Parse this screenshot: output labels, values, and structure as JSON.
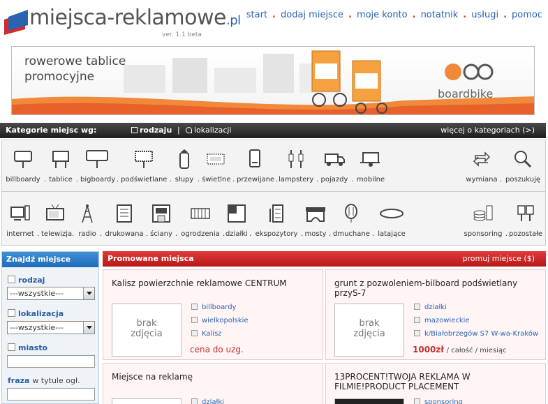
{
  "header": {
    "logo_text": "miejsca-reklamowe",
    "logo_tld": ".pl",
    "version": "ver. 1.1 beta",
    "nav": [
      "start",
      "dodaj miejsce",
      "moje konto",
      "notatnik",
      "usługi",
      "pomoc"
    ]
  },
  "banner": {
    "line1": "rowerowe tablice",
    "line2": "promocyjne",
    "brand": "boardbike"
  },
  "categories_bar": {
    "title": "Kategorie miejsc wg:",
    "mode_type": "rodzaju",
    "separator": "|",
    "mode_location": "lokalizacji",
    "more": "więcej o kategoriach (>)"
  },
  "categories_row1": [
    "billboardy",
    "tablice",
    "bigboardy",
    "podświetlane",
    "słupy",
    "świetlne",
    "przewijane",
    "lampstery",
    "pojazdy",
    "mobilne"
  ],
  "categories_row1_right": [
    "wymiana",
    "poszukuję"
  ],
  "categories_row2": [
    "internet",
    "telewizja",
    "radio",
    "drukowana",
    "ściany",
    "ogrodzenia",
    "działki",
    "ekspozytory",
    "mosty",
    "dmuchane",
    "latające"
  ],
  "categories_row2_right": [
    "sponsoring",
    "pozostałe"
  ],
  "sidebar": {
    "title": "Znajdź miejsce",
    "type_label": "rodzaj",
    "type_value": "---wszystkie---",
    "location_label": "lokalizacja",
    "location_value": "---wszystkie---",
    "city_label": "miasto",
    "phrase_label": "fraza",
    "phrase_sub": "w tytule ogł."
  },
  "main": {
    "title": "Promowane miejsca",
    "promote": "promuj miejsce ($)",
    "no_photo_1": "brak",
    "no_photo_2": "zdjęcia",
    "cards": [
      {
        "title": "Kalisz powierzchnie reklamowe CENTRUM",
        "cat": "billboardy",
        "region": "wielkopolskie",
        "place": "Kalisz",
        "price": "cena do uzg.",
        "price_extra": ""
      },
      {
        "title": "grunt z pozwoleniem-bilboard podświetlany przyS-7",
        "cat": "działki",
        "region": "mazowieckie",
        "place": "k/Białobrzegów S7 W-wa-Kraków",
        "price": "1000zł",
        "price_extra": "/ całość / miesiąc"
      },
      {
        "title": "Miejsce na reklamę",
        "cat": "działki"
      },
      {
        "title": "13PROCENT!TWOJA REKLAMA W FILMIE!PRODUCT PLACEMENT",
        "cat": "sponsoring"
      }
    ]
  },
  "colors": {
    "nav_link": "#2a63b0",
    "accent_red": "#c81e1e",
    "accent_blue": "#1f6bb8"
  }
}
